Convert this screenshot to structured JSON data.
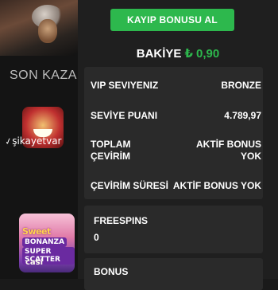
{
  "background": {
    "section_label": "SON KAZAN",
    "watermark": "şikayetvar",
    "game_tile_text": [
      "Sweet",
      "BONANZA",
      "SUPER SCATTER",
      "casi"
    ]
  },
  "panel": {
    "lost_bonus_button": "KAYIP BONUSU AL",
    "balance_label": "BAKİYE",
    "balance_value": "₺ 0,90",
    "info": {
      "vip_level_label": "VIP SEVIYENIZ",
      "vip_level_value": "BRONZE",
      "level_points_label": "SEVİYE PUANI",
      "level_points_value": "4.789,97",
      "total_turnover_label": "TOPLAM ÇEVİRİM",
      "total_turnover_value": "AKTİF BONUS YOK",
      "turnover_period_label": "ÇEVİRİM SÜRESİ",
      "turnover_period_value": "AKTİF BONUS YOK"
    },
    "freespins_label": "FREESPINS",
    "freespins_value": "0",
    "bonus_label": "BONUS"
  },
  "colors": {
    "accent_green": "#2db84d",
    "panel_bg": "#1f1f1f",
    "card_bg": "#2a2a2a"
  }
}
